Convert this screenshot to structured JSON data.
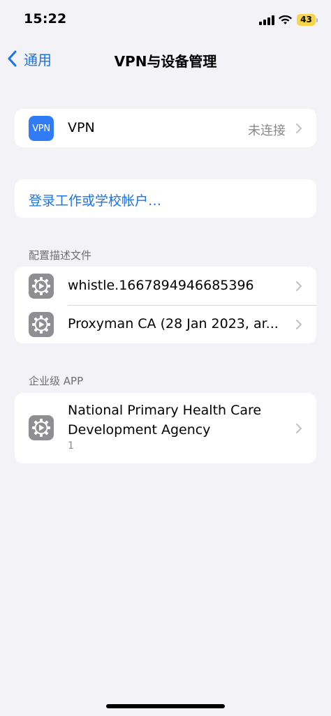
{
  "status_bar": {
    "time": "15:22",
    "battery": "43"
  },
  "nav": {
    "back_label": "通用",
    "title": "VPN与设备管理"
  },
  "vpn_group": {
    "icon_text": "VPN",
    "label": "VPN",
    "value": "未连接"
  },
  "work_account": {
    "label": "登录工作或学校帐户…"
  },
  "profiles": {
    "header": "配置描述文件",
    "items": [
      {
        "label": "whistle.1667894946685396"
      },
      {
        "label": "Proxyman CA (28 Jan 2023, ar..."
      }
    ]
  },
  "enterprise": {
    "header": "企业级 APP",
    "items": [
      {
        "line1": "National Primary Health Care",
        "line2": "Development Agency",
        "count": "1"
      }
    ]
  },
  "colors": {
    "accent": "#1a73e8",
    "background": "#f2f2f7",
    "vpn_icon": "#2f7cf6",
    "gear_icon": "#8e8e93",
    "battery": "#f5d64b"
  }
}
